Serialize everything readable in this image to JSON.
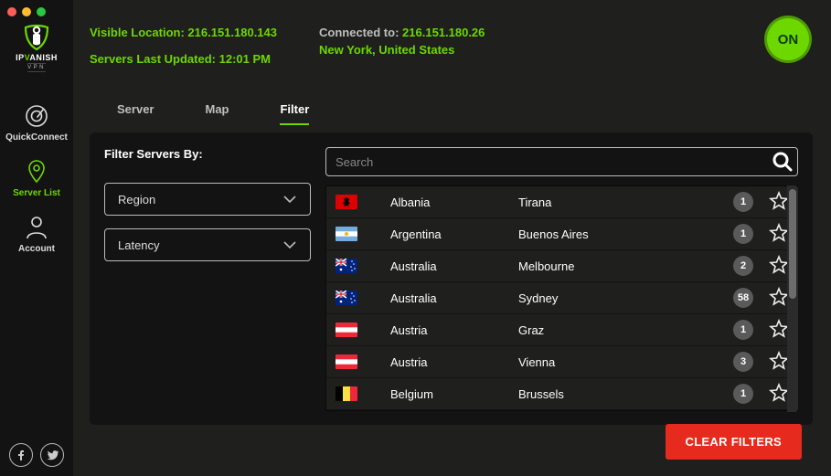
{
  "brand": {
    "name": "IPVANISH",
    "sub": "VPN"
  },
  "sidebar": {
    "items": [
      {
        "label": "QuickConnect"
      },
      {
        "label": "Server List"
      },
      {
        "label": "Account"
      }
    ]
  },
  "header": {
    "visible_label": "Visible Location:",
    "visible_value": "216.151.180.143",
    "updated_label": "Servers Last Updated:",
    "updated_value": "12:01 PM",
    "connected_label": "Connected to:",
    "connected_value": "216.151.180.26",
    "location": "New York, United States",
    "on_label": "ON"
  },
  "tabs": [
    {
      "label": "Server"
    },
    {
      "label": "Map"
    },
    {
      "label": "Filter"
    }
  ],
  "panel": {
    "filters_title": "Filter Servers By:",
    "region_label": "Region",
    "latency_label": "Latency",
    "search_placeholder": "Search",
    "clear_label": "CLEAR FILTERS"
  },
  "servers": [
    {
      "country": "Albania",
      "city": "Tirana",
      "count": "1",
      "flag": "al"
    },
    {
      "country": "Argentina",
      "city": "Buenos Aires",
      "count": "1",
      "flag": "ar"
    },
    {
      "country": "Australia",
      "city": "Melbourne",
      "count": "2",
      "flag": "au"
    },
    {
      "country": "Australia",
      "city": "Sydney",
      "count": "58",
      "flag": "au"
    },
    {
      "country": "Austria",
      "city": "Graz",
      "count": "1",
      "flag": "at"
    },
    {
      "country": "Austria",
      "city": "Vienna",
      "count": "3",
      "flag": "at"
    },
    {
      "country": "Belgium",
      "city": "Brussels",
      "count": "1",
      "flag": "be"
    }
  ]
}
